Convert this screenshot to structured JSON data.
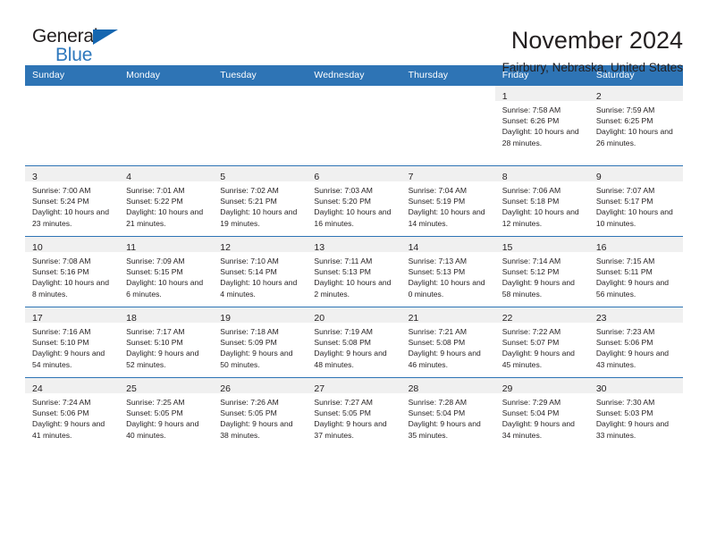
{
  "brand": {
    "name_part1": "General",
    "name_part2": "Blue",
    "accent_color": "#2e78bd",
    "triangle_color": "#1566b0"
  },
  "header": {
    "title": "November 2024",
    "location": "Fairbury, Nebraska, United States"
  },
  "theme": {
    "header_blue": "#2e74b5",
    "daystrip_gray": "#f0f0f0",
    "text_color": "#231f20"
  },
  "calendar": {
    "weekday_headers": [
      "Sunday",
      "Monday",
      "Tuesday",
      "Wednesday",
      "Thursday",
      "Friday",
      "Saturday"
    ],
    "labels": {
      "sunrise": "Sunrise:",
      "sunset": "Sunset:",
      "daylight": "Daylight:"
    },
    "weeks": [
      [
        {
          "blank": true
        },
        {
          "blank": true
        },
        {
          "blank": true
        },
        {
          "blank": true
        },
        {
          "blank": true
        },
        {
          "day": "1",
          "sunrise": "Sunrise: 7:58 AM",
          "sunset": "Sunset: 6:26 PM",
          "daylight": "Daylight: 10 hours and 28 minutes."
        },
        {
          "day": "2",
          "sunrise": "Sunrise: 7:59 AM",
          "sunset": "Sunset: 6:25 PM",
          "daylight": "Daylight: 10 hours and 26 minutes."
        }
      ],
      [
        {
          "day": "3",
          "sunrise": "Sunrise: 7:00 AM",
          "sunset": "Sunset: 5:24 PM",
          "daylight": "Daylight: 10 hours and 23 minutes."
        },
        {
          "day": "4",
          "sunrise": "Sunrise: 7:01 AM",
          "sunset": "Sunset: 5:22 PM",
          "daylight": "Daylight: 10 hours and 21 minutes."
        },
        {
          "day": "5",
          "sunrise": "Sunrise: 7:02 AM",
          "sunset": "Sunset: 5:21 PM",
          "daylight": "Daylight: 10 hours and 19 minutes."
        },
        {
          "day": "6",
          "sunrise": "Sunrise: 7:03 AM",
          "sunset": "Sunset: 5:20 PM",
          "daylight": "Daylight: 10 hours and 16 minutes."
        },
        {
          "day": "7",
          "sunrise": "Sunrise: 7:04 AM",
          "sunset": "Sunset: 5:19 PM",
          "daylight": "Daylight: 10 hours and 14 minutes."
        },
        {
          "day": "8",
          "sunrise": "Sunrise: 7:06 AM",
          "sunset": "Sunset: 5:18 PM",
          "daylight": "Daylight: 10 hours and 12 minutes."
        },
        {
          "day": "9",
          "sunrise": "Sunrise: 7:07 AM",
          "sunset": "Sunset: 5:17 PM",
          "daylight": "Daylight: 10 hours and 10 minutes."
        }
      ],
      [
        {
          "day": "10",
          "sunrise": "Sunrise: 7:08 AM",
          "sunset": "Sunset: 5:16 PM",
          "daylight": "Daylight: 10 hours and 8 minutes."
        },
        {
          "day": "11",
          "sunrise": "Sunrise: 7:09 AM",
          "sunset": "Sunset: 5:15 PM",
          "daylight": "Daylight: 10 hours and 6 minutes."
        },
        {
          "day": "12",
          "sunrise": "Sunrise: 7:10 AM",
          "sunset": "Sunset: 5:14 PM",
          "daylight": "Daylight: 10 hours and 4 minutes."
        },
        {
          "day": "13",
          "sunrise": "Sunrise: 7:11 AM",
          "sunset": "Sunset: 5:13 PM",
          "daylight": "Daylight: 10 hours and 2 minutes."
        },
        {
          "day": "14",
          "sunrise": "Sunrise: 7:13 AM",
          "sunset": "Sunset: 5:13 PM",
          "daylight": "Daylight: 10 hours and 0 minutes."
        },
        {
          "day": "15",
          "sunrise": "Sunrise: 7:14 AM",
          "sunset": "Sunset: 5:12 PM",
          "daylight": "Daylight: 9 hours and 58 minutes."
        },
        {
          "day": "16",
          "sunrise": "Sunrise: 7:15 AM",
          "sunset": "Sunset: 5:11 PM",
          "daylight": "Daylight: 9 hours and 56 minutes."
        }
      ],
      [
        {
          "day": "17",
          "sunrise": "Sunrise: 7:16 AM",
          "sunset": "Sunset: 5:10 PM",
          "daylight": "Daylight: 9 hours and 54 minutes."
        },
        {
          "day": "18",
          "sunrise": "Sunrise: 7:17 AM",
          "sunset": "Sunset: 5:10 PM",
          "daylight": "Daylight: 9 hours and 52 minutes."
        },
        {
          "day": "19",
          "sunrise": "Sunrise: 7:18 AM",
          "sunset": "Sunset: 5:09 PM",
          "daylight": "Daylight: 9 hours and 50 minutes."
        },
        {
          "day": "20",
          "sunrise": "Sunrise: 7:19 AM",
          "sunset": "Sunset: 5:08 PM",
          "daylight": "Daylight: 9 hours and 48 minutes."
        },
        {
          "day": "21",
          "sunrise": "Sunrise: 7:21 AM",
          "sunset": "Sunset: 5:08 PM",
          "daylight": "Daylight: 9 hours and 46 minutes."
        },
        {
          "day": "22",
          "sunrise": "Sunrise: 7:22 AM",
          "sunset": "Sunset: 5:07 PM",
          "daylight": "Daylight: 9 hours and 45 minutes."
        },
        {
          "day": "23",
          "sunrise": "Sunrise: 7:23 AM",
          "sunset": "Sunset: 5:06 PM",
          "daylight": "Daylight: 9 hours and 43 minutes."
        }
      ],
      [
        {
          "day": "24",
          "sunrise": "Sunrise: 7:24 AM",
          "sunset": "Sunset: 5:06 PM",
          "daylight": "Daylight: 9 hours and 41 minutes."
        },
        {
          "day": "25",
          "sunrise": "Sunrise: 7:25 AM",
          "sunset": "Sunset: 5:05 PM",
          "daylight": "Daylight: 9 hours and 40 minutes."
        },
        {
          "day": "26",
          "sunrise": "Sunrise: 7:26 AM",
          "sunset": "Sunset: 5:05 PM",
          "daylight": "Daylight: 9 hours and 38 minutes."
        },
        {
          "day": "27",
          "sunrise": "Sunrise: 7:27 AM",
          "sunset": "Sunset: 5:05 PM",
          "daylight": "Daylight: 9 hours and 37 minutes."
        },
        {
          "day": "28",
          "sunrise": "Sunrise: 7:28 AM",
          "sunset": "Sunset: 5:04 PM",
          "daylight": "Daylight: 9 hours and 35 minutes."
        },
        {
          "day": "29",
          "sunrise": "Sunrise: 7:29 AM",
          "sunset": "Sunset: 5:04 PM",
          "daylight": "Daylight: 9 hours and 34 minutes."
        },
        {
          "day": "30",
          "sunrise": "Sunrise: 7:30 AM",
          "sunset": "Sunset: 5:03 PM",
          "daylight": "Daylight: 9 hours and 33 minutes."
        }
      ]
    ]
  }
}
